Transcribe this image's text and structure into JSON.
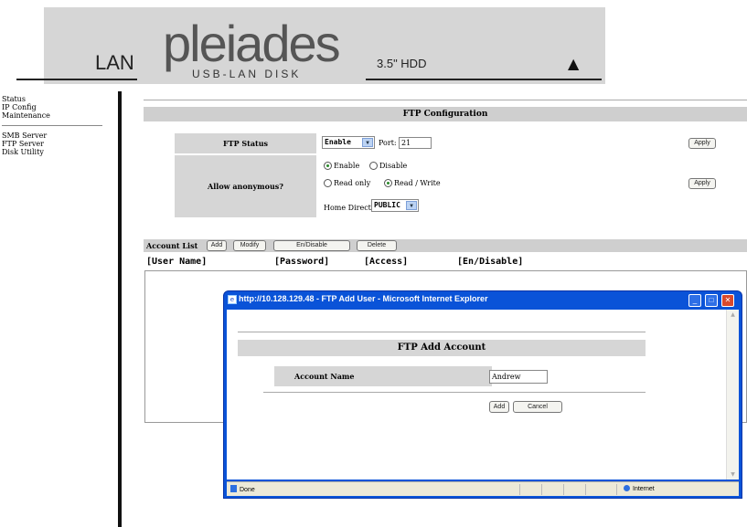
{
  "banner": {
    "section": "LAN",
    "logo": "pleiades",
    "subtitle": "USB-LAN DISK",
    "model": "3.5\" HDD",
    "corner_icon": "triangle-logo-icon"
  },
  "nav": {
    "group1": [
      "Status",
      "IP Config",
      "Maintenance"
    ],
    "group2": [
      "SMB Server",
      "FTP Server",
      "Disk Utility"
    ]
  },
  "ftp": {
    "title": "FTP Configuration",
    "status_label": "FTP Status",
    "status_value": "Enable",
    "port_label": "Port:",
    "port_value": "21",
    "apply": "Apply",
    "anon_label": "Allow anonymous?",
    "anon_enable": "Enable",
    "anon_disable": "Disable",
    "mode_readonly": "Read only",
    "mode_readwrite": "Read / Write",
    "home_dir_label": "Home Directory:",
    "home_dir_value": "PUBLIC",
    "anon_enable_checked": true,
    "mode_readwrite_checked": true
  },
  "account_list": {
    "label": "Account List",
    "buttons": [
      "Add",
      "Modify",
      "En/Disable",
      "Delete"
    ],
    "columns": [
      "[User Name]",
      "[Password]",
      "[Access]",
      "[En/Disable]"
    ]
  },
  "popup": {
    "title": "http://10.128.129.48 - FTP Add User - Microsoft Internet Explorer",
    "heading": "FTP Add Account",
    "account_name_label": "Account Name",
    "account_name_value": "Andrew",
    "add": "Add",
    "cancel": "Cancel",
    "status_done": "Done",
    "status_zone": "Internet"
  }
}
